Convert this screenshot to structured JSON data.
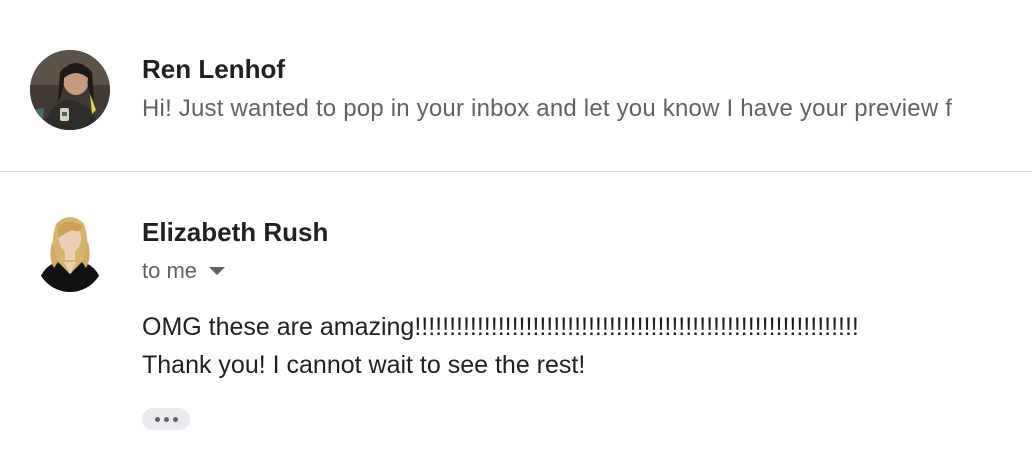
{
  "messages": [
    {
      "sender": "Ren Lenhof",
      "snippet": "Hi! Just wanted to pop in your inbox and let you know I have your preview f",
      "state": "collapsed"
    },
    {
      "sender": "Elizabeth Rush",
      "recipient_line": "to me",
      "body": [
        "OMG these are amazing!!!!!!!!!!!!!!!!!!!!!!!!!!!!!!!!!!!!!!!!!!!!!!!!!!!!!!!!!!!!!!!!",
        "Thank you! I cannot wait to see the rest!"
      ],
      "state": "expanded"
    }
  ],
  "icons": {
    "recipient_details": "chevron-down-icon",
    "show_trimmed_content": "more-horiz-icon"
  },
  "colors": {
    "text_primary": "#202124",
    "text_secondary": "#5f6368",
    "divider": "#e0e0e0",
    "chip_bg": "#e8eaed"
  }
}
